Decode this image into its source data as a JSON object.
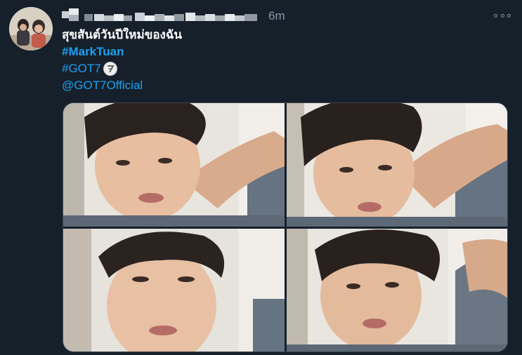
{
  "tweet": {
    "timestamp": "6m",
    "lines": {
      "thai": "สุขสันต์วันปีใหม่ของฉัน",
      "hashtag_marktuan": "#MarkTuan",
      "hashtag_got7": "#GOT7",
      "mention": "@GOT7Official"
    },
    "emoji": "got7-logo-emoji"
  },
  "colors": {
    "background": "#15202b",
    "link": "#1da1f2",
    "muted": "#8899a6",
    "border": "#38444d"
  },
  "icons": [
    "avatar",
    "more-options-icon",
    "got7-logo-emoji"
  ]
}
